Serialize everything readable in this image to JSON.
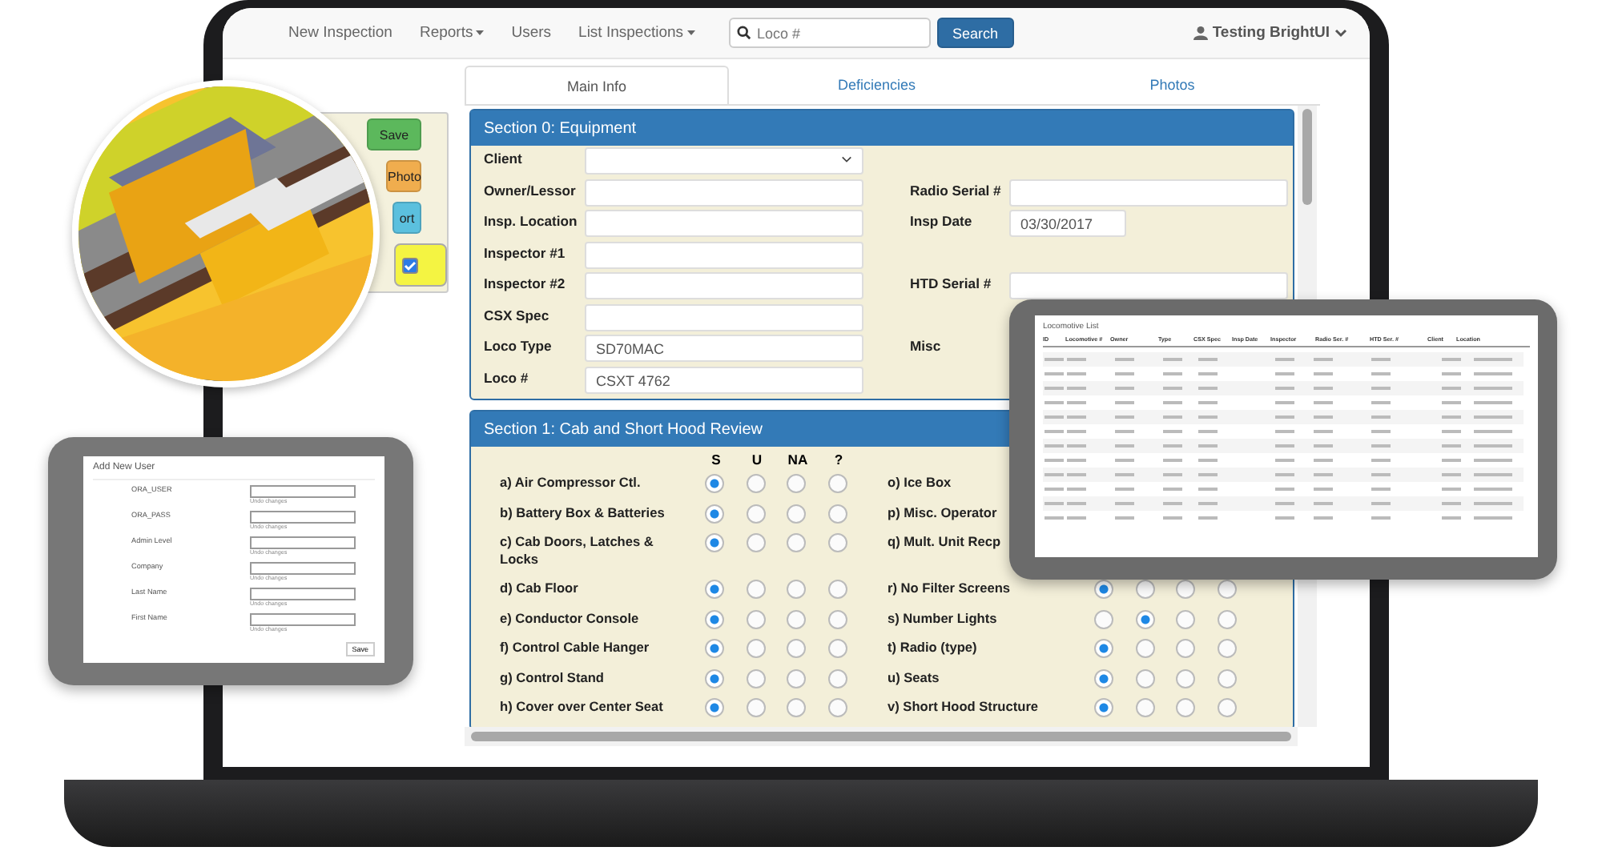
{
  "nav": {
    "items": [
      {
        "label": "New Inspection",
        "dropdown": false
      },
      {
        "label": "Reports",
        "dropdown": true
      },
      {
        "label": "Users",
        "dropdown": false
      },
      {
        "label": "List Inspections",
        "dropdown": true
      }
    ],
    "search": {
      "placeholder": "Loco #",
      "button": "Search"
    },
    "user": "Testing BrightUI"
  },
  "side_actions": [
    {
      "kind": "button",
      "label": "Save",
      "color": "#5cb85c"
    },
    {
      "kind": "button",
      "label": "Photo",
      "color": "#f0ad4e"
    },
    {
      "kind": "button",
      "label": "ort",
      "color": "#5bc0de"
    },
    {
      "kind": "checkbox",
      "checked": true,
      "color": "#f4f442"
    }
  ],
  "tabs": [
    {
      "label": "Main Info",
      "selected": true
    },
    {
      "label": "Deficiencies",
      "selected": false
    },
    {
      "label": "Photos",
      "selected": false
    }
  ],
  "section_0": {
    "title": "Section 0: Equipment",
    "rows": [
      {
        "left": {
          "label": "Client",
          "kind": "select"
        }
      },
      {
        "left": {
          "label": "Owner/Lessor",
          "kind": "input"
        },
        "right": {
          "label": "Radio Serial #",
          "kind": "input"
        }
      },
      {
        "left": {
          "label": "Insp. Location",
          "kind": "input"
        },
        "right": {
          "label": "Insp Date",
          "kind": "date",
          "value": "03/30/2017"
        }
      },
      {
        "left": {
          "label": "Inspector #1",
          "kind": "input"
        }
      },
      {
        "left": {
          "label": "Inspector #2",
          "kind": "input"
        },
        "right": {
          "label": "HTD Serial #",
          "kind": "input"
        }
      },
      {
        "left": {
          "label": "CSX Spec",
          "kind": "input"
        }
      },
      {
        "left": {
          "label": "Loco Type",
          "kind": "input",
          "value": "SD70MAC"
        },
        "right": {
          "label": "Misc",
          "kind": "label"
        }
      },
      {
        "left": {
          "label": "Loco #",
          "kind": "input",
          "value": "CSXT 4762"
        }
      }
    ]
  },
  "section_1": {
    "title": "Section 1: Cab and Short Hood Review",
    "columns": [
      "S",
      "U",
      "NA",
      "?"
    ],
    "left_items": [
      {
        "label": "a) Air Compressor Ctl.",
        "choices": [
          {
            "selected": true
          },
          {
            "selected": false
          },
          {
            "selected": false
          },
          {
            "selected": false
          }
        ]
      },
      {
        "label": "b) Battery Box & Batteries",
        "choices": [
          {
            "selected": true
          },
          {
            "selected": false
          },
          {
            "selected": false
          },
          {
            "selected": false
          }
        ]
      },
      {
        "label": "c) Cab Doors, Latches & Locks",
        "choices": [
          {
            "selected": true
          },
          {
            "selected": false
          },
          {
            "selected": false
          },
          {
            "selected": false
          }
        ]
      },
      {
        "label": "d) Cab Floor",
        "choices": [
          {
            "selected": true
          },
          {
            "selected": false
          },
          {
            "selected": false
          },
          {
            "selected": false
          }
        ]
      },
      {
        "label": "e) Conductor Console",
        "choices": [
          {
            "selected": true
          },
          {
            "selected": false
          },
          {
            "selected": false
          },
          {
            "selected": false
          }
        ]
      },
      {
        "label": "f) Control Cable Hanger",
        "choices": [
          {
            "selected": true
          },
          {
            "selected": false
          },
          {
            "selected": false
          },
          {
            "selected": false
          }
        ]
      },
      {
        "label": "g) Control Stand",
        "choices": [
          {
            "selected": true
          },
          {
            "selected": false
          },
          {
            "selected": false
          },
          {
            "selected": false
          }
        ]
      },
      {
        "label": "h) Cover over Center Seat",
        "choices": [
          {
            "selected": true
          },
          {
            "selected": false
          },
          {
            "selected": false
          },
          {
            "selected": false
          }
        ]
      }
    ],
    "right_items": [
      {
        "label": "o) Ice Box"
      },
      {
        "label": "p) Misc. Operator"
      },
      {
        "label": "q) Mult. Unit Recp"
      },
      {
        "label": "r) No Filter Screens",
        "choices": [
          {
            "selected": true
          },
          {
            "selected": false
          },
          {
            "selected": false
          },
          {
            "selected": false
          }
        ]
      },
      {
        "label": "s) Number Lights",
        "choices": [
          {
            "selected": false
          },
          {
            "selected": true
          },
          {
            "selected": false
          },
          {
            "selected": false
          }
        ]
      },
      {
        "label": "t) Radio (type)",
        "choices": [
          {
            "selected": true
          },
          {
            "selected": false
          },
          {
            "selected": false
          },
          {
            "selected": false
          }
        ]
      },
      {
        "label": "u) Seats",
        "choices": [
          {
            "selected": true
          },
          {
            "selected": false
          },
          {
            "selected": false
          },
          {
            "selected": false
          }
        ]
      },
      {
        "label": "v) Short Hood Structure",
        "choices": [
          {
            "selected": true
          },
          {
            "selected": false
          },
          {
            "selected": false
          },
          {
            "selected": false
          }
        ]
      }
    ]
  },
  "add_user_tablet": {
    "title": "Add New User",
    "fields": [
      {
        "label": "ORA_USER",
        "hint": "Undo changes"
      },
      {
        "label": "ORA_PASS",
        "hint": "Undo changes"
      },
      {
        "label": "Admin Level",
        "hint": "Undo changes"
      },
      {
        "label": "Company",
        "hint": "Undo changes"
      },
      {
        "label": "Last Name",
        "hint": "Undo changes"
      },
      {
        "label": "First Name",
        "hint": "Undo changes"
      }
    ],
    "button": "Save"
  },
  "locomotive_tablet": {
    "title": "Locomotive List",
    "columns": [
      "ID",
      "Locomotive #",
      "Owner",
      "Type",
      "CSX Spec",
      "Insp Date",
      "Inspector",
      "Radio Ser. #",
      "HTD Ser. #",
      "Client",
      "Location"
    ]
  }
}
